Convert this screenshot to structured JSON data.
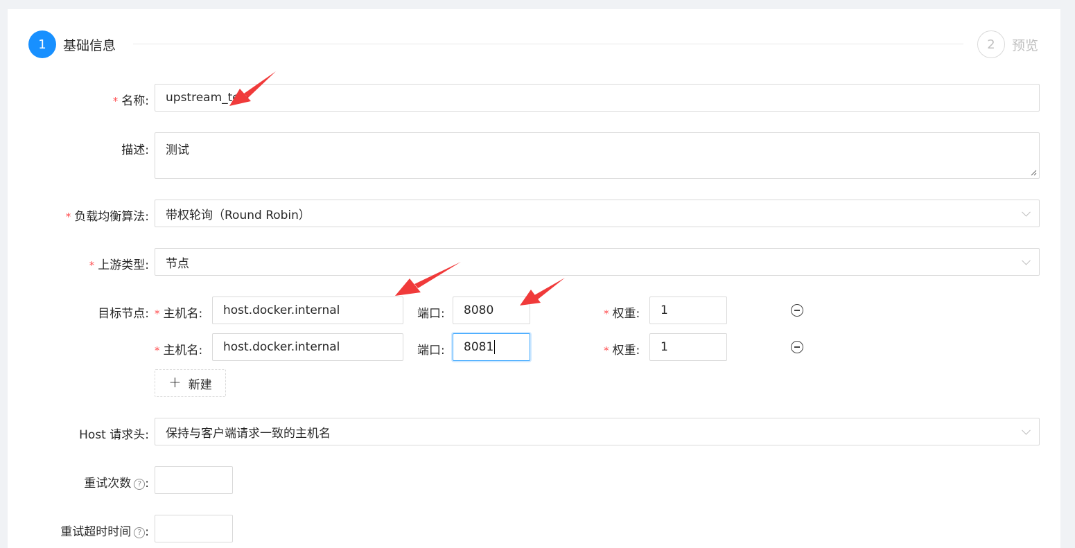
{
  "steps": [
    {
      "number": "1",
      "title": "基础信息"
    },
    {
      "number": "2",
      "title": "预览"
    }
  ],
  "form": {
    "name": {
      "label": "名称",
      "value": "upstream_test"
    },
    "desc": {
      "label": "描述",
      "value": "测试"
    },
    "lb": {
      "label": "负载均衡算法",
      "value": "带权轮询（Round Robin）"
    },
    "upstream_type": {
      "label": "上游类型",
      "value": "节点"
    },
    "targets": {
      "label": "目标节点",
      "host_label": "主机名",
      "port_label": "端口",
      "weight_label": "权重",
      "rows": [
        {
          "host": "host.docker.internal",
          "port": "8080",
          "weight": "1"
        },
        {
          "host": "host.docker.internal",
          "port": "8081",
          "weight": "1"
        }
      ],
      "add_label": "新建"
    },
    "host_header": {
      "label": "Host 请求头",
      "value": "保持与客户端请求一致的主机名"
    },
    "retries": {
      "label": "重试次数",
      "value": ""
    },
    "retry_timeout": {
      "label": "重试超时时间",
      "value": ""
    }
  },
  "colors": {
    "primary": "#1890ff",
    "required": "#ff4d4f",
    "annotation_arrow": "#f03a3a"
  },
  "icons": {
    "remove": "minus-circle-icon",
    "add": "plus-icon",
    "help": "question-circle-icon",
    "select": "chevron-down-icon"
  }
}
